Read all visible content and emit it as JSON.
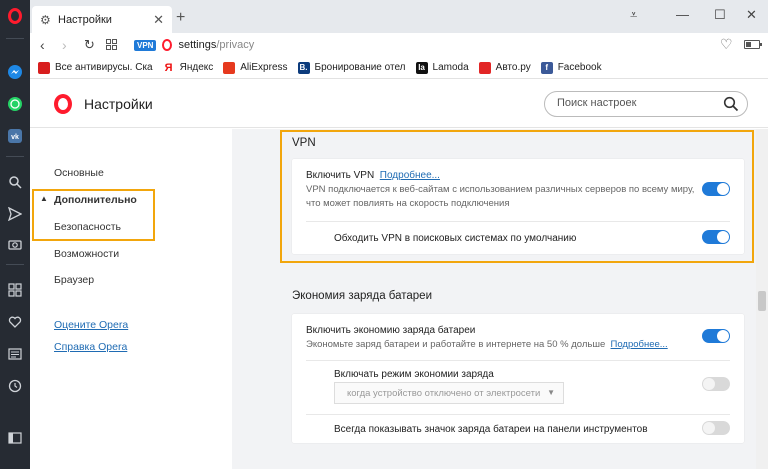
{
  "tab": {
    "title": "Настройки",
    "new_tab": "+"
  },
  "window_controls": {
    "menu": "⩡",
    "minimize": "—",
    "maximize": "☐",
    "close": "✕"
  },
  "address": {
    "vpn_badge": "VPN",
    "url_host": "settings",
    "url_path": "/privacy"
  },
  "bookmarks": [
    {
      "label": "Все антивирусы. Ска",
      "icon": "red-square-icon",
      "color": "#d81e1e",
      "glyph": ""
    },
    {
      "label": "Яндекс",
      "icon": "yandex-icon",
      "color": "#ffffff",
      "glyph": "Я"
    },
    {
      "label": "AliExpress",
      "icon": "aliexpress-icon",
      "color": "#e6391e",
      "glyph": ""
    },
    {
      "label": "Бронирование отел",
      "icon": "booking-icon",
      "color": "#0c3b7c",
      "glyph": "B."
    },
    {
      "label": "Lamoda",
      "icon": "lamoda-icon",
      "color": "#111111",
      "glyph": "la"
    },
    {
      "label": "Авто.ру",
      "icon": "autoru-icon",
      "color": "#e22626",
      "glyph": ""
    },
    {
      "label": "Facebook",
      "icon": "facebook-icon",
      "color": "#3b5998",
      "glyph": "f"
    }
  ],
  "header": {
    "title": "Настройки",
    "search_placeholder": "Поиск настроек"
  },
  "nav": {
    "basic": "Основные",
    "advanced": "Дополнительно",
    "advanced_arrow": "▲",
    "security": "Безопасность",
    "features": "Возможности",
    "browser": "Браузер",
    "rate": "Оцените Opera",
    "help": "Справка Opera"
  },
  "vpn": {
    "section": "VPN",
    "enable_label": "Включить VPN",
    "more_link": "Подробнее...",
    "enable_desc_1": "VPN подключается к веб-сайтам с использованием различных серверов по всему миру,",
    "enable_desc_2": "что может повлиять на скорость подключения",
    "enable_on": true,
    "bypass_label": "Обходить VPN в поисковых системах по умолчанию",
    "bypass_on": true
  },
  "battery": {
    "section": "Экономия заряда батареи",
    "enable_label": "Включить экономию заряда батареи",
    "enable_desc": "Экономьте заряд батареи и работайте в интернете на 50 % дольше",
    "more_link": "Подробнее...",
    "enable_on": true,
    "mode_label": "Включать режим экономии заряда",
    "mode_value": "когда устройство отключено от электросети",
    "mode_on": false,
    "icon_label": "Всегда показывать значок заряда батареи на панели инструментов",
    "icon_on": false
  },
  "colors": {
    "accent": "#1f7ad8",
    "highlight": "#f2a60c",
    "opera_red": "#ff1b2d"
  }
}
